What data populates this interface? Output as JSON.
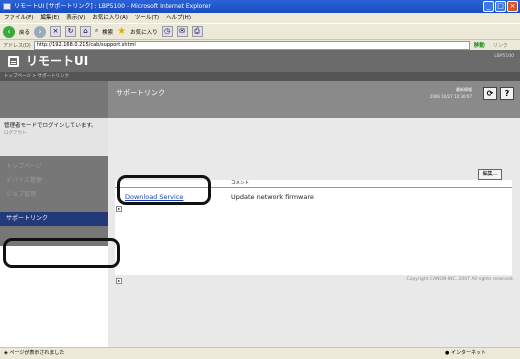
{
  "window": {
    "title": "リモートUI [サポートリンク] : LBP5100 - Microsoft Internet Explorer"
  },
  "menubar": {
    "items": [
      "ファイル(F)",
      "編集(E)",
      "表示(V)",
      "お気に入り(A)",
      "ツール(T)",
      "ヘルプ(H)"
    ]
  },
  "toolbar": {
    "back_label": "戻る",
    "search_label": "検索",
    "favorites_label": "お気に入り"
  },
  "addressbar": {
    "label": "アドレス(D)",
    "url": "http://192.168.0.215/cab/support.shtml",
    "go_label": "移動",
    "links_label": "リンク"
  },
  "header": {
    "title": "リモートUI",
    "model": "LBP5100"
  },
  "breadcrumb": "トップページ > サポートリンク",
  "sidebar": {
    "login_text": "管理者モードでログインしています。",
    "logout_label": "ログアウト",
    "nav": [
      {
        "label": "トップページ"
      },
      {
        "label": "デバイス管理"
      },
      {
        "label": "ジョブ管理"
      },
      {
        "label": "サポートリンク"
      }
    ]
  },
  "content": {
    "page_title": "サポートリンク",
    "latest_label": "最新情報",
    "datetime": "2006 10/27 10:30:07",
    "edit_label": "編集...",
    "table": {
      "comment_header": "コメント",
      "rows": [
        {
          "link": "Download Service",
          "comment": "Update network firmware"
        }
      ]
    },
    "copyright": "Copyright CANON INC. 2007 All rights reserved."
  },
  "statusbar": {
    "status": "ページが表示されました",
    "zone": "インターネット"
  },
  "colors": {
    "header_bg": "#6b6b6b",
    "active_nav": "#223a7a",
    "link": "#1a3fb0"
  }
}
